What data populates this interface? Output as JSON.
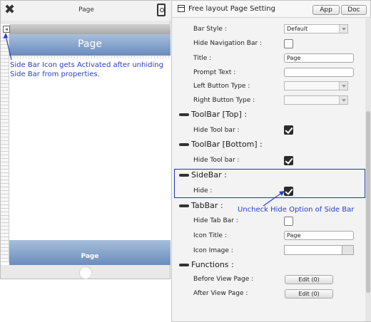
{
  "phone": {
    "title": "Page",
    "navbar_title": "Page",
    "toolbar_label": "Page",
    "annotation": "Side Bar Icon gets Activated after unhiding Side Bar from properties."
  },
  "panel": {
    "title": "Free layout Page Setting",
    "app_button": "App",
    "doc_button": "Doc",
    "rows": {
      "bar_style": {
        "label": "Bar Style :",
        "value": "Default"
      },
      "hide_navigation_bar": {
        "label": "Hide Navigation Bar :",
        "checked": false
      },
      "title": {
        "label": "Title :",
        "value": "Page"
      },
      "prompt_text": {
        "label": "Prompt Text :",
        "value": ""
      },
      "left_button_type": {
        "label": "Left Button Type :",
        "value": ""
      },
      "right_button_type": {
        "label": "Right Button Type :",
        "value": ""
      }
    },
    "toolbar_top": {
      "label": "ToolBar [Top] :",
      "hide_label": "Hide Tool bar :",
      "checked": true
    },
    "toolbar_bottom": {
      "label": "ToolBar [Bottom] :",
      "hide_label": "Hide Tool bar :",
      "checked": true
    },
    "sidebar": {
      "label": "SideBar :",
      "hide_label": "Hide :",
      "checked": true
    },
    "tabbar": {
      "label": "TabBar :",
      "hide_label": "Hide Tab Bar :",
      "hide_checked": false,
      "icon_title_label": "Icon Title :",
      "icon_title_value": "Page",
      "icon_image_label": "Icon Image :"
    },
    "functions": {
      "label": "Functions :",
      "before_label": "Before View Page :",
      "before_button": "Edit (0)",
      "after_label": "After View Page :",
      "after_button": "Edit (0)"
    },
    "annotation": "Uncheck Hide Option of Side Bar"
  },
  "colors": {
    "annotation": "#2b3ec4",
    "highlight": "#2333b8",
    "bar_gradient_top": "#a7bfdc",
    "bar_gradient_bottom": "#6a8cbc"
  }
}
